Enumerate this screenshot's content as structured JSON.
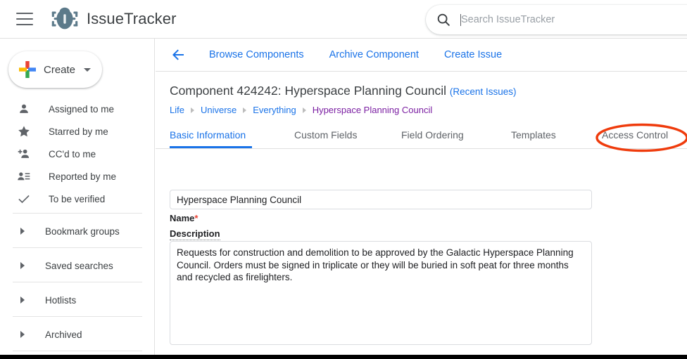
{
  "header": {
    "menu_icon": "hamburger-icon",
    "logo_icon": "bug-icon",
    "brand": "IssueTracker",
    "search": {
      "icon": "search-icon",
      "placeholder": "Search IssueTracker",
      "value": ""
    }
  },
  "sidebar": {
    "create": {
      "label": "Create",
      "icon": "plus-icon",
      "caret": "chevron-down-icon"
    },
    "items": [
      {
        "label": "Assigned to me",
        "icon": "person-icon"
      },
      {
        "label": "Starred by me",
        "icon": "star-icon"
      },
      {
        "label": "CC'd to me",
        "icon": "person-add-icon"
      },
      {
        "label": "Reported by me",
        "icon": "person-list-icon"
      },
      {
        "label": "To be verified",
        "icon": "check-icon"
      }
    ],
    "groups": [
      {
        "label": "Bookmark groups",
        "icon": "triangle-right-icon"
      },
      {
        "label": "Saved searches",
        "icon": "triangle-right-icon"
      },
      {
        "label": "Hotlists",
        "icon": "triangle-right-icon"
      },
      {
        "label": "Archived",
        "icon": "triangle-right-icon"
      }
    ]
  },
  "content": {
    "back_icon": "arrow-left-icon",
    "actions": [
      "Browse Components",
      "Archive Component",
      "Create Issue"
    ],
    "title": "Component 424242: Hyperspace Planning Council",
    "title_link": "(Recent Issues)",
    "breadcrumb": [
      "Life",
      "Universe",
      "Everything",
      "Hyperspace Planning Council"
    ],
    "tabs": [
      {
        "label": "Basic Information",
        "active": true
      },
      {
        "label": "Custom Fields",
        "active": false
      },
      {
        "label": "Field Ordering",
        "active": false
      },
      {
        "label": "Templates",
        "active": false
      },
      {
        "label": "Access Control",
        "active": false
      }
    ],
    "form": {
      "name_label": "Name",
      "name_required": "*",
      "name_value": "Hyperspace Planning Council",
      "description_label": "Description",
      "description_value": "Requests for construction and demolition to be approved by the Galactic Hyperspace Planning Council. Orders must be signed in triplicate or they will be buried in soft peat for three months and recycled as firelighters."
    }
  },
  "annotation": {
    "target": "Access Control",
    "shape": "ellipse",
    "color": "#ef3b0c"
  },
  "colors": {
    "link_blue": "#1a73e8",
    "visited_purple": "#7b1fa2",
    "required_red": "#ea4335",
    "annotation_orange": "#ef3b0c",
    "logo_slate": "#5c7a8a"
  }
}
